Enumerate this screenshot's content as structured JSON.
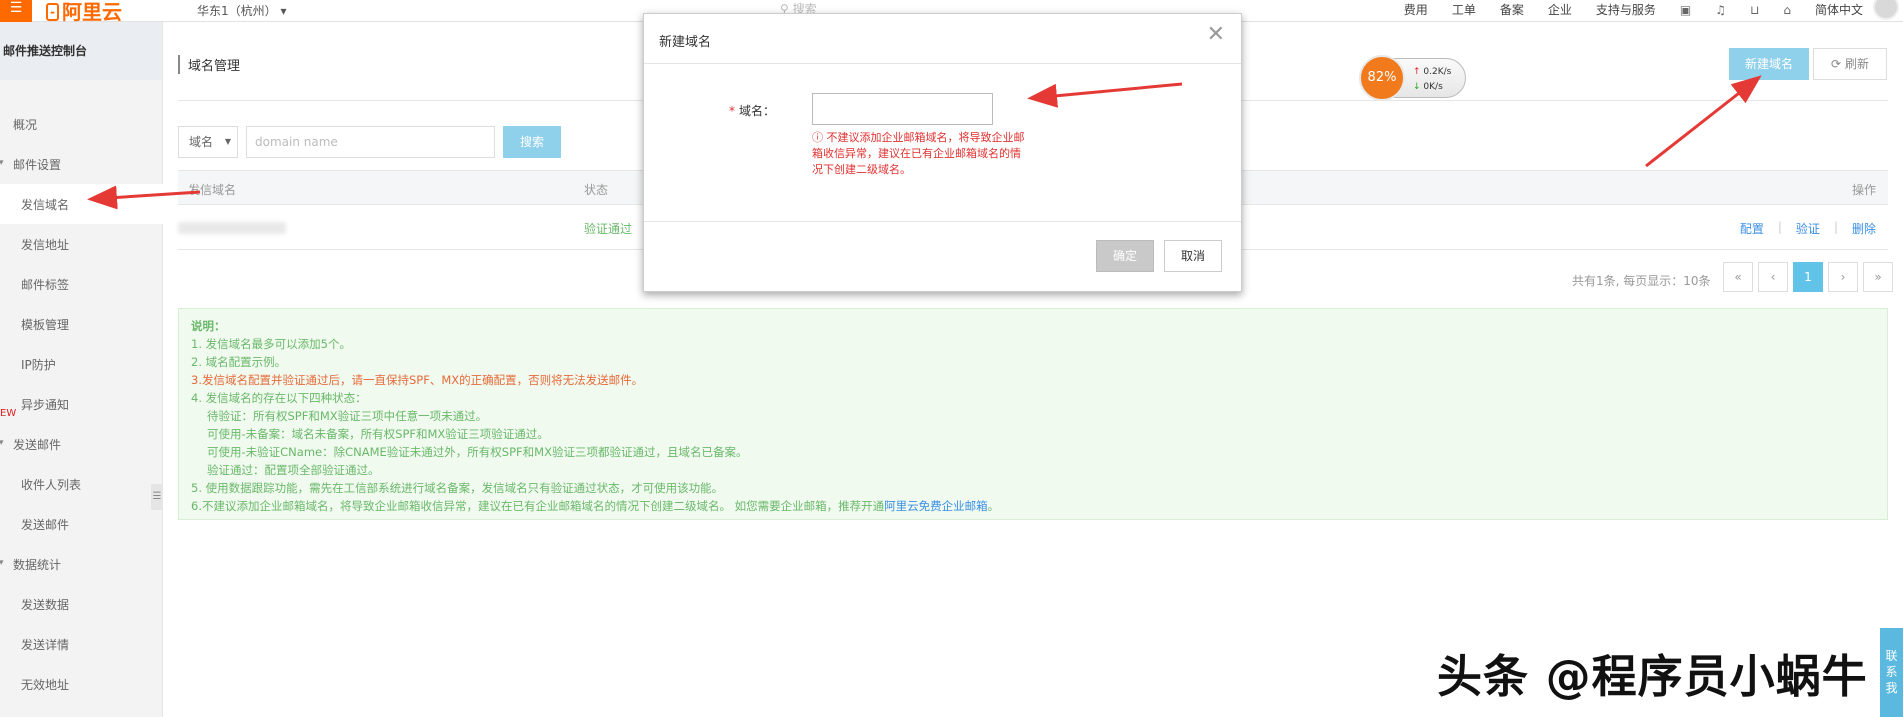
{
  "topbar": {
    "menu_icon": "hamburger-icon",
    "logo_text": "阿里云",
    "region": "华东1（杭州）",
    "search_placeholder": "搜索",
    "nav": [
      "费用",
      "工单",
      "备案",
      "企业",
      "支持与服务"
    ],
    "language": "简体中文",
    "icons": [
      "terminal-icon",
      "bell-icon",
      "cart-icon",
      "home-icon"
    ]
  },
  "sidebar": {
    "title": "邮件推送控制台",
    "items": {
      "overview": "概况",
      "mail_settings": "邮件设置",
      "sender_domain": "发信域名",
      "sender_address": "发信地址",
      "mail_tags": "邮件标签",
      "templates": "模板管理",
      "ip_protection": "IP防护",
      "async_notify": "异步通知",
      "send_mail": "发送邮件",
      "recipients": "收件人列表",
      "send": "发送邮件",
      "statistics": "数据统计",
      "send_data": "发送数据",
      "send_detail": "发送详情",
      "invalid_address": "无效地址"
    },
    "new_tag": "EW"
  },
  "main": {
    "page_title": "域名管理",
    "new_button": "新建域名",
    "refresh_button": "刷新",
    "filter": {
      "select_value": "域名",
      "input_placeholder": "domain name",
      "search_button": "搜索"
    },
    "table": {
      "columns": [
        "发信域名",
        "状态",
        "操作"
      ],
      "rows": [
        {
          "status": "验证通过",
          "actions": [
            "配置",
            "验证",
            "删除"
          ]
        }
      ]
    },
    "pagination": {
      "info": "共有1条, 每页显示：10条",
      "first": "«",
      "prev": "‹",
      "current": "1",
      "next": "›",
      "last": "»"
    },
    "notes": {
      "heading": "说明：",
      "line1": "1. 发信域名最多可以添加5个。",
      "line2": "2. 域名配置示例。",
      "line3": "3.发信域名配置并验证通过后，请一直保持SPF、MX的正确配置，否则将无法发送邮件。",
      "line4": "4. 发信域名的存在以下四种状态：",
      "line4a": "待验证：所有权SPF和MX验证三项中任意一项未通过。",
      "line4b": "可使用-未备案：域名未备案，所有权SPF和MX验证三项验证通过。",
      "line4c": "可使用-未验证CName：除CNAME验证未通过外，所有权SPF和MX验证三项都验证通过，且域名已备案。",
      "line4d": "验证通过：配置项全部验证通过。",
      "line5": "5. 使用数据跟踪功能，需先在工信部系统进行域名备案，发信域名只有验证通过状态，才可使用该功能。",
      "line6": "6.不建议添加企业邮箱域名，将导致企业邮箱收信异常，建议在已有企业邮箱域名的情况下创建二级域名。 如您需要企业邮箱，推荐开通",
      "line6_link": "阿里云免费企业邮箱",
      "line6_end": "。"
    }
  },
  "net_widget": {
    "percent": "82%",
    "up": "0.2K/s",
    "down": "0K/s"
  },
  "modal": {
    "title": "新建域名",
    "field_label": "域名：",
    "required_mark": "*",
    "error_text": "不建议添加企业邮箱域名，将导致企业邮箱收信异常，建议在已有企业邮箱域名的情况下创建二级域名。",
    "ok_button": "确定",
    "cancel_button": "取消"
  },
  "watermark": "头条 @程序员小蜗牛",
  "contact_tab": "联系我",
  "colors": {
    "brand": "#ff6a00",
    "primary_button": "#8fd0ea",
    "arrow": "#e53935",
    "success": "#6ab86a",
    "link": "#3a8ee6",
    "error": "#e03030"
  }
}
